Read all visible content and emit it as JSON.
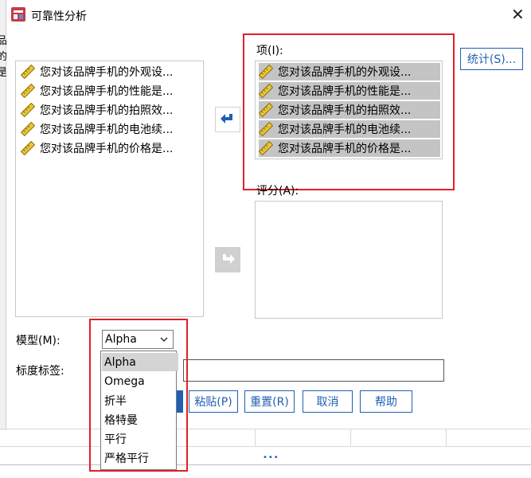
{
  "window": {
    "title": "可靠性分析",
    "close_glyph": "✕"
  },
  "background": {
    "left_chars": [
      "品",
      "的",
      "是"
    ],
    "dots": "•••"
  },
  "source_list": {
    "items": [
      "您对该品牌手机的外观设...",
      "您对该品牌手机的性能是...",
      "您对该品牌手机的拍照效...",
      "您对该品牌手机的电池续...",
      "您对该品牌手机的价格是..."
    ]
  },
  "items_panel": {
    "label": "项(I):",
    "items": [
      "您对该品牌手机的外观设...",
      "您对该品牌手机的性能是...",
      "您对该品牌手机的拍照效...",
      "您对该品牌手机的电池续...",
      "您对该品牌手机的价格是..."
    ]
  },
  "rater_panel": {
    "label": "评分(A):"
  },
  "buttons": {
    "statistics": "统计(S)...",
    "paste": "粘贴(P)",
    "reset": "重置(R)",
    "cancel": "取消",
    "help": "帮助"
  },
  "model": {
    "label": "模型(M):",
    "selected": "Alpha",
    "options": [
      "Alpha",
      "Omega",
      "折半",
      "格特曼",
      "平行",
      "严格平行"
    ]
  },
  "scale_label": {
    "label": "标度标签:",
    "value": ""
  },
  "colors": {
    "accent": "#1f5fb5",
    "highlight": "#e0202a",
    "selection": "#c4c4c4"
  }
}
